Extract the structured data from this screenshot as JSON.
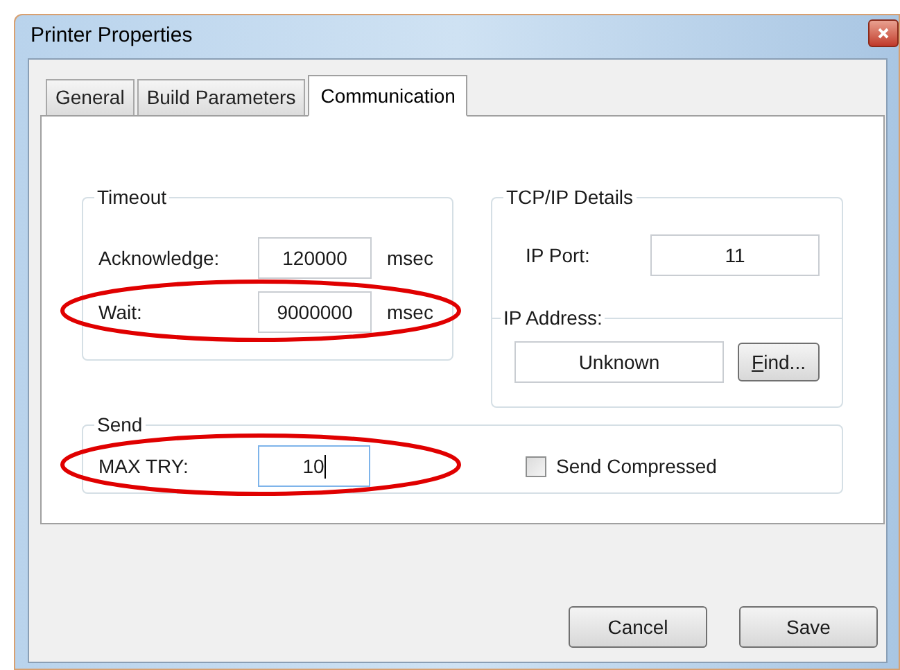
{
  "window": {
    "title": "Printer Properties"
  },
  "tabs": [
    {
      "label": "General",
      "selected": false
    },
    {
      "label": "Build Parameters",
      "selected": false
    },
    {
      "label": "Communication",
      "selected": true
    }
  ],
  "timeout": {
    "label": "Timeout",
    "rows": [
      {
        "label": "Acknowledge:",
        "value": "120000",
        "unit": "msec",
        "highlighted": false
      },
      {
        "label": "Wait:",
        "value": "9000000",
        "unit": "msec",
        "highlighted": true
      }
    ]
  },
  "tcpip": {
    "label": "TCP/IP Details",
    "port_label": "IP Port:",
    "port_value": "11",
    "address": {
      "label": "IP Address:",
      "value": "Unknown",
      "button": "Find...",
      "access_key_underlined": true
    }
  },
  "send": {
    "label": "Send",
    "max_try_label": "MAX TRY:",
    "max_try_value": "10",
    "focused": true,
    "highlighted": true,
    "compress": {
      "label": "Send Compressed",
      "checked": false
    }
  },
  "buttons": [
    "Cancel",
    "Save"
  ]
}
